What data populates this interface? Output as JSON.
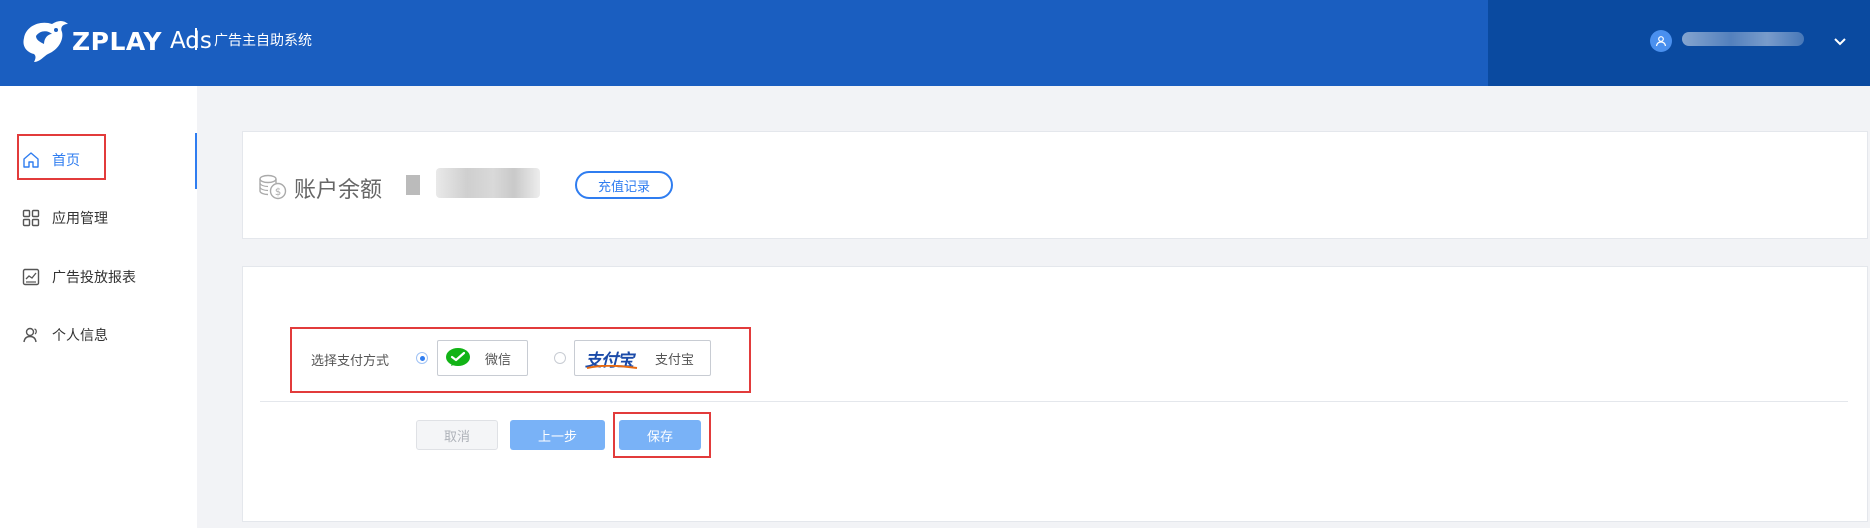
{
  "header": {
    "brand": "ZPLAY",
    "brand_suffix": "Ads",
    "system_title": "广告主自助系统"
  },
  "sidebar": {
    "items": [
      {
        "label": "首页",
        "icon": "home-icon"
      },
      {
        "label": "应用管理",
        "icon": "apps-grid-icon"
      },
      {
        "label": "广告投放报表",
        "icon": "chart-report-icon"
      },
      {
        "label": "个人信息",
        "icon": "user-icon"
      }
    ]
  },
  "balance": {
    "label": "账户余额",
    "recharge_button": "充值记录",
    "icon": "coins-icon"
  },
  "payment": {
    "label": "选择支付方式",
    "options": [
      {
        "label": "微信",
        "icon": "wechat-icon",
        "selected": true
      },
      {
        "label": "支付宝",
        "icon": "alipay-logo",
        "logo_text": "支付宝",
        "selected": false
      }
    ]
  },
  "actions": {
    "cancel": "取消",
    "prev": "上一步",
    "save": "保存"
  },
  "colors": {
    "header_bg": "#1a5ec0",
    "header_right_bg": "#0a4aa0",
    "accent": "#2f7df0",
    "highlight_box": "#e23b3b"
  }
}
